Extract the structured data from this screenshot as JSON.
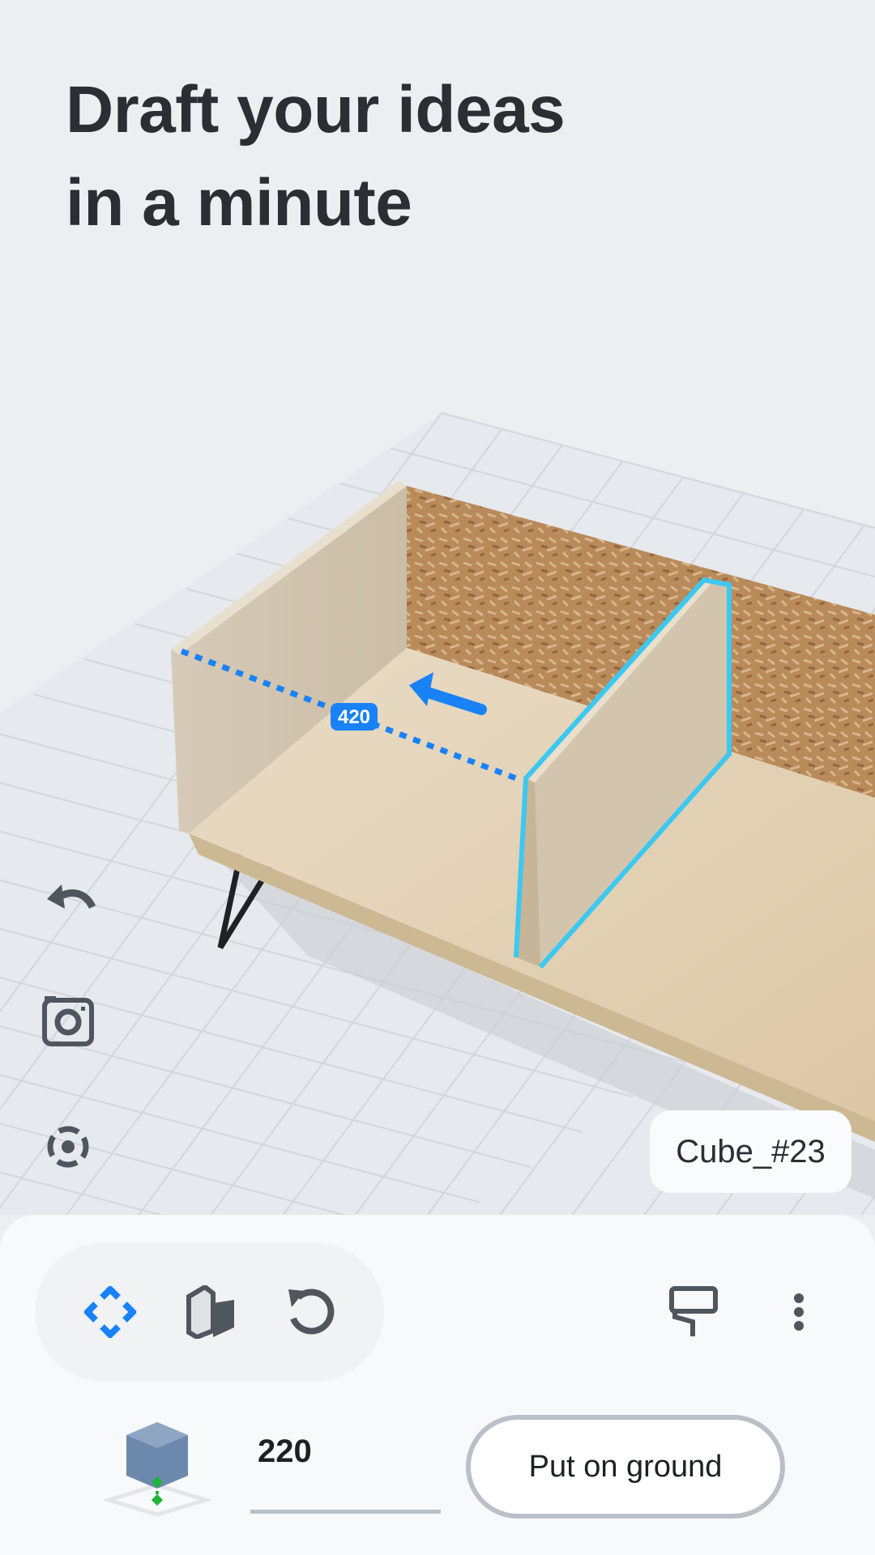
{
  "headline": {
    "line1": "Draft your ideas",
    "line2": "in a minute"
  },
  "viewport": {
    "dimension_label": "420",
    "selected_object": "Cube_#23",
    "side_tools": [
      {
        "icon": "undo-icon"
      },
      {
        "icon": "camera-icon"
      },
      {
        "icon": "focus-target-icon"
      }
    ]
  },
  "bottom_sheet": {
    "tools": [
      {
        "icon": "move-arrows-icon",
        "active": true
      },
      {
        "icon": "panel-cube-icon",
        "active": false
      },
      {
        "icon": "rotate-icon",
        "active": false
      }
    ],
    "paint_icon": "paint-roller-icon",
    "more_icon": "more-vertical-icon",
    "elevation_icon": "cube-elevation-icon",
    "elevation_value": "220",
    "put_on_ground_label": "Put on ground"
  },
  "colors": {
    "accent": "#1a82f7",
    "selection": "#3cc8f0",
    "text": "#2b2e33"
  }
}
